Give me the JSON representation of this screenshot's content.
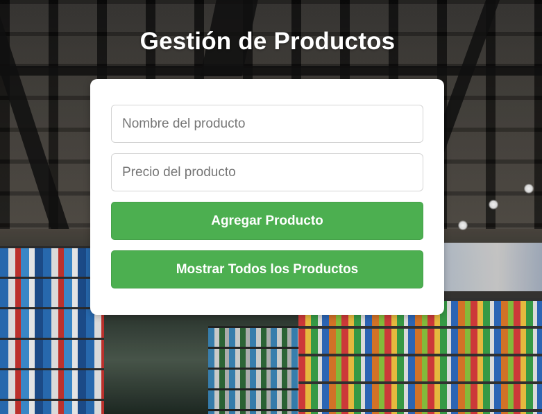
{
  "page": {
    "title": "Gestión de Productos"
  },
  "form": {
    "name_placeholder": "Nombre del producto",
    "price_placeholder": "Precio del producto",
    "name_value": "",
    "price_value": "",
    "add_button_label": "Agregar Producto",
    "show_all_button_label": "Mostrar Todos los Productos"
  },
  "colors": {
    "button_green": "#4caf50",
    "card_background": "#ffffff",
    "title_text": "#ffffff"
  }
}
